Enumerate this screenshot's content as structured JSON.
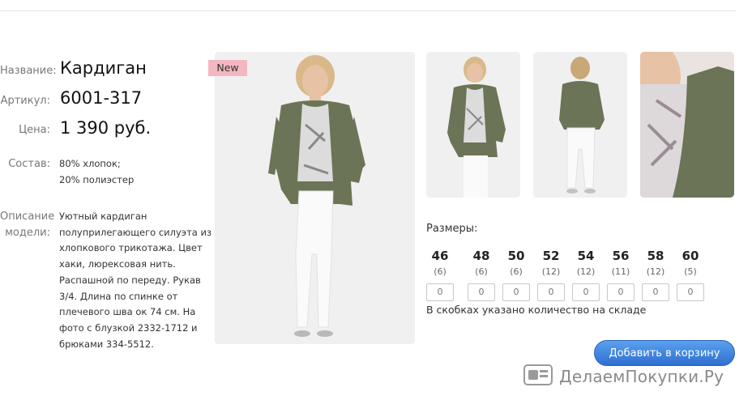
{
  "product": {
    "name_label": "Название:",
    "name": "Кардиган",
    "article_label": "Артикул:",
    "article": "6001-317",
    "price_label": "Цена:",
    "price": "1 390 руб.",
    "composition_label": "Состав:",
    "composition": [
      "80% хлопок;",
      "20% полиэстер"
    ],
    "description_label": [
      "Описание",
      "модели:"
    ],
    "description_lines": [
      "Уютный кардиган",
      "полуприлегающего силуэта из",
      "хлопкового трикотажа. Цвет",
      "хаки, люрексовая нить.",
      "Распашной по переду. Рукав",
      "3/4. Длина по спинке от",
      "плечевого шва ок 74 см. На",
      "фото с блузкой 2332-1712 и",
      "брюками 334-5512."
    ]
  },
  "badge": "New",
  "sizes": {
    "title": "Размеры:",
    "items": [
      {
        "size": "46",
        "stock": "(6)",
        "qty": "0"
      },
      {
        "size": "48",
        "stock": "(6)",
        "qty": "0"
      },
      {
        "size": "50",
        "stock": "(6)",
        "qty": "0"
      },
      {
        "size": "52",
        "stock": "(12)",
        "qty": "0"
      },
      {
        "size": "54",
        "stock": "(12)",
        "qty": "0"
      },
      {
        "size": "56",
        "stock": "(11)",
        "qty": "0"
      },
      {
        "size": "58",
        "stock": "(12)",
        "qty": "0"
      },
      {
        "size": "60",
        "stock": "(5)",
        "qty": "0"
      }
    ],
    "note": "В скобках указано количество на складе"
  },
  "cart_button": "Добавить в корзину",
  "watermark": "ДелаемПокупки.Ру",
  "colors": {
    "accent": "#3a7fe0",
    "badge": "#f4b7c2",
    "cardigan": "#6b7456"
  }
}
